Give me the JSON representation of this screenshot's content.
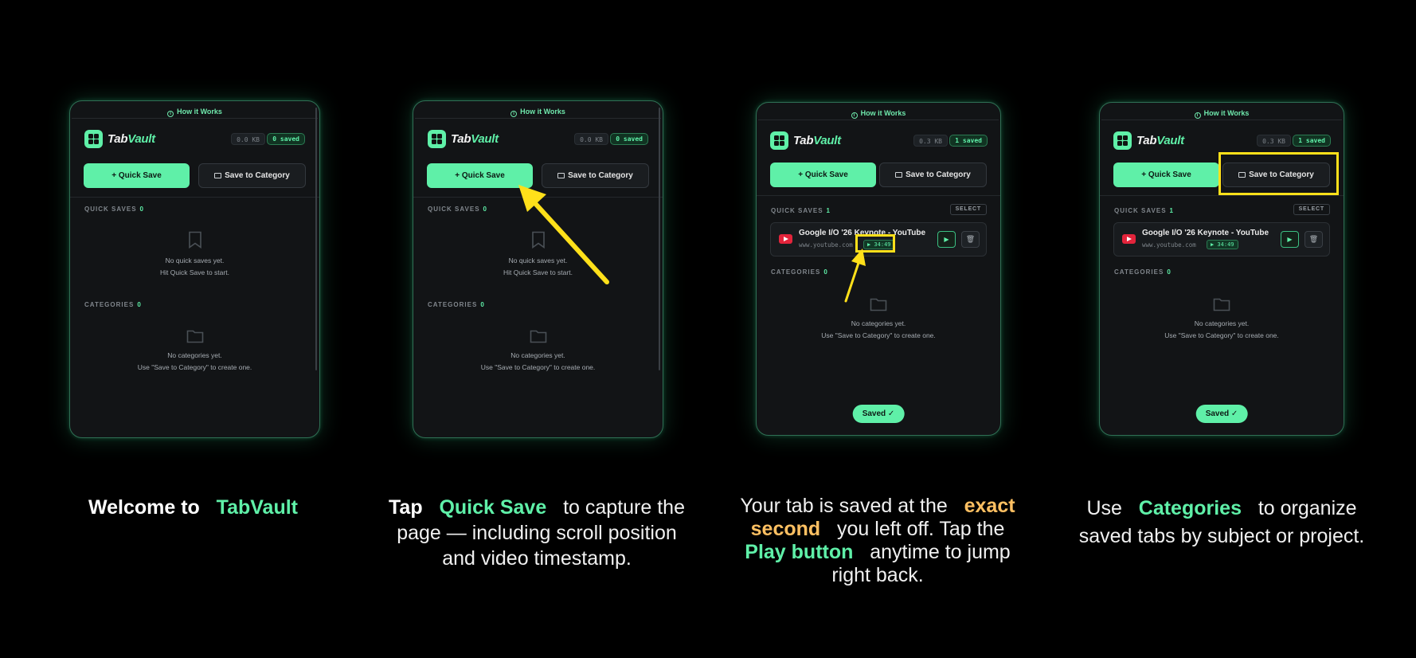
{
  "accent_color": "#5ff0a8",
  "highlight_color": "#ffe01a",
  "panels": [
    {
      "how_it_works": "How it Works",
      "logo": {
        "part1": "Tab",
        "part2": "Vault"
      },
      "storage": "0.0 KB",
      "saved_count": "0 saved",
      "quick_save": "Quick Save",
      "save_to_category": "Save to Category",
      "quick_saves_label": "QUICK SAVES",
      "quick_saves_count": "0",
      "quick_empty_line1": "No quick saves yet.",
      "quick_empty_line2": "Hit Quick Save to start.",
      "categories_label": "CATEGORIES",
      "categories_count": "0",
      "cat_empty_line1": "No categories yet.",
      "cat_empty_line2": "Use \"Save to Category\" to create one."
    },
    {
      "how_it_works": "How it Works",
      "logo": {
        "part1": "Tab",
        "part2": "Vault"
      },
      "storage": "0.0 KB",
      "saved_count": "0 saved",
      "quick_save": "Quick Save",
      "save_to_category": "Save to Category",
      "quick_saves_label": "QUICK SAVES",
      "quick_saves_count": "0",
      "quick_empty_line1": "No quick saves yet.",
      "quick_empty_line2": "Hit Quick Save to start.",
      "categories_label": "CATEGORIES",
      "categories_count": "0",
      "cat_empty_line1": "No categories yet.",
      "cat_empty_line2": "Use \"Save to Category\" to create one."
    },
    {
      "how_it_works": "How it Works",
      "logo": {
        "part1": "Tab",
        "part2": "Vault"
      },
      "storage": "0.3 KB",
      "saved_count": "1 saved",
      "quick_save": "Quick Save",
      "save_to_category": "Save to Category",
      "quick_saves_label": "QUICK SAVES",
      "quick_saves_count": "1",
      "select": "SELECT",
      "item_title": "Google I/O '26 Keynote - YouTube",
      "item_url": "www.youtube.com",
      "item_timestamp": "▶ 34:49",
      "categories_label": "CATEGORIES",
      "categories_count": "0",
      "cat_empty_line1": "No categories yet.",
      "cat_empty_line2": "Use \"Save to Category\" to create one.",
      "toast": "Saved ✓"
    },
    {
      "how_it_works": "How it Works",
      "logo": {
        "part1": "Tab",
        "part2": "Vault"
      },
      "storage": "0.3 KB",
      "saved_count": "1 saved",
      "quick_save": "Quick Save",
      "save_to_category": "Save to Category",
      "quick_saves_label": "QUICK SAVES",
      "quick_saves_count": "1",
      "select": "SELECT",
      "item_title": "Google I/O '26 Keynote - YouTube",
      "item_url": "www.youtube.com",
      "item_timestamp": "▶ 34:49",
      "categories_label": "CATEGORIES",
      "categories_count": "0",
      "cat_empty_line1": "No categories yet.",
      "cat_empty_line2": "Use \"Save to Category\" to create one.",
      "toast": "Saved ✓"
    }
  ],
  "captions": [
    {
      "pre": "Welcome to",
      "brand": "TabVault"
    },
    {
      "tap": "Tap",
      "quick_save": "Quick Save",
      "line1_rest": "to capture the",
      "line2": "page — including scroll position",
      "line3": "and video timestamp."
    },
    {
      "line1_pre": "Your tab is saved at the",
      "exact": "exact",
      "second": "second",
      "line2_rest": "you left off. Tap the",
      "play_button": "Play button",
      "line3_rest": "anytime to jump",
      "line4": "right back."
    },
    {
      "use": "Use",
      "categories": "Categories",
      "line1_rest": "to organize",
      "line2": "saved tabs by subject or project."
    }
  ]
}
